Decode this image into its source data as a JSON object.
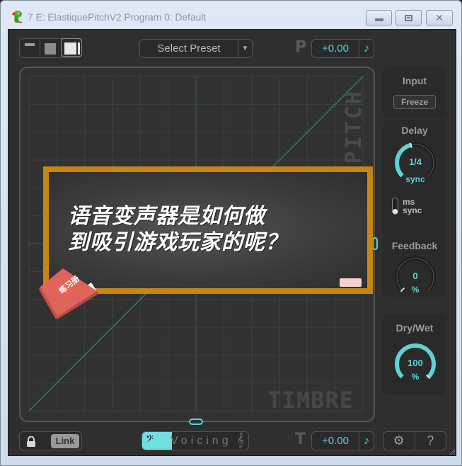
{
  "window": {
    "title": "7 E: ElastiquePitchV2 Program 0: Default",
    "icon": "frog-app-icon",
    "buttons": {
      "minimize": "minimize",
      "maximize": "maximize",
      "close": "close"
    }
  },
  "toolbar": {
    "view_modes": [
      "compact",
      "medium",
      "full"
    ],
    "active_view_mode": "full",
    "preset_label": "Select Preset",
    "pitch": {
      "letter": "P",
      "value": "+0.00",
      "note_icon": "♪"
    }
  },
  "graph": {
    "y_axis_label": "PITCH",
    "x_axis_label": "TIMBRE",
    "grid_columns": 12,
    "grid_rows": 12
  },
  "right_panel": {
    "input": {
      "title": "Input",
      "freeze_label": "Freeze"
    },
    "delay": {
      "title": "Delay",
      "value": "1/4",
      "unit": "sync",
      "level": 0.45,
      "toggle_options": [
        "ms",
        "sync"
      ],
      "toggle_selected": "sync"
    },
    "feedback": {
      "title": "Feedback",
      "value": "0",
      "unit": "%",
      "level": 0.0
    },
    "dry_wet": {
      "title": "Dry/Wet",
      "value": "100",
      "unit": "%",
      "level": 1.0
    }
  },
  "bottom_bar": {
    "link_label": "Link",
    "voicing": {
      "label": "Voicing",
      "bass_icon": "𝄢",
      "treble_icon": "𝄞",
      "level": 0.28
    },
    "timbre": {
      "letter": "T",
      "value": "+0.00",
      "note_icon": "♪"
    },
    "settings_icon": "⚙",
    "help_label": "?"
  },
  "overlay_ad": {
    "headline_line1": "语音变声器是如何做",
    "headline_line2": "到吸引游戏玩家的呢？",
    "book_label": "练习册"
  },
  "colors": {
    "accent": "#5fd3d3",
    "panel_bg": "#2f2f2f",
    "frame": "#c58613"
  }
}
